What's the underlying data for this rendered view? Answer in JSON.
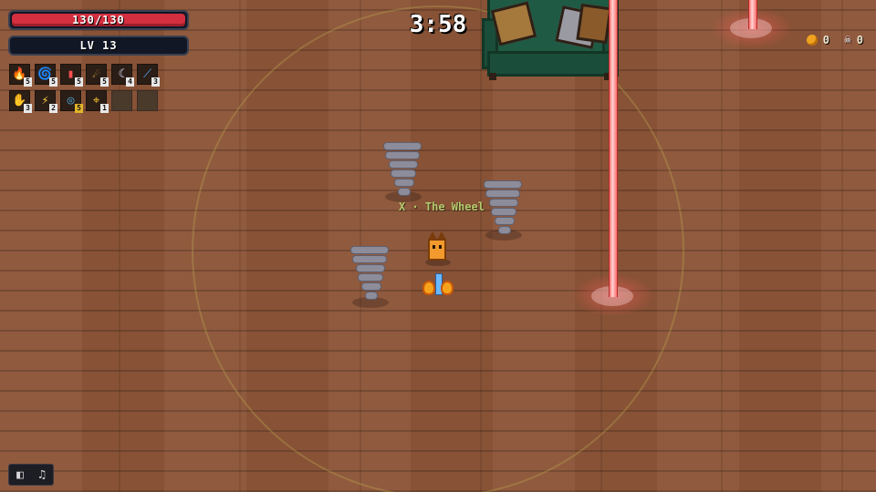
{
  "hud": {
    "hp": {
      "text": "130/130",
      "current": 130,
      "max": 130
    },
    "level": {
      "text": "LV 13"
    },
    "timer": "3:58",
    "coins": "0",
    "kills": "0"
  },
  "skills": {
    "row1": [
      {
        "icon": "fire-pot-icon",
        "glyph": "🔥",
        "level": "5"
      },
      {
        "icon": "wind-spiral-icon",
        "glyph": "🌀",
        "level": "5"
      },
      {
        "icon": "laser-pillar-icon",
        "glyph": "▮",
        "level": "5"
      },
      {
        "icon": "fireball-icon",
        "glyph": "☄",
        "level": "5"
      },
      {
        "icon": "crescent-slash-icon",
        "glyph": "☾",
        "level": "4"
      },
      {
        "icon": "blue-sword-icon",
        "glyph": "⟋",
        "level": "3"
      }
    ],
    "row2": [
      {
        "icon": "red-paw-icon",
        "glyph": "✋",
        "level": "3",
        "gold": false
      },
      {
        "icon": "golden-claw-icon",
        "glyph": "⚡",
        "level": "2",
        "gold": false
      },
      {
        "icon": "ring-vortex-icon",
        "glyph": "◎",
        "level": "5",
        "gold": true
      },
      {
        "icon": "target-reticle-icon",
        "glyph": "⌖",
        "level": "1",
        "gold": false
      },
      {
        "icon": "empty-slot",
        "glyph": "",
        "level": ""
      },
      {
        "icon": "empty-slot",
        "glyph": "",
        "level": ""
      }
    ]
  },
  "enemy": {
    "label": "X · The Wheel"
  },
  "controls": {
    "sfx_glyph": "◧",
    "music_glyph": "♫"
  },
  "colors": {
    "hp": "#d42f3f",
    "floor": "#8c5538",
    "couch": "#1f5a45",
    "laser": "#ff6b6b",
    "aura": "#bea850"
  }
}
